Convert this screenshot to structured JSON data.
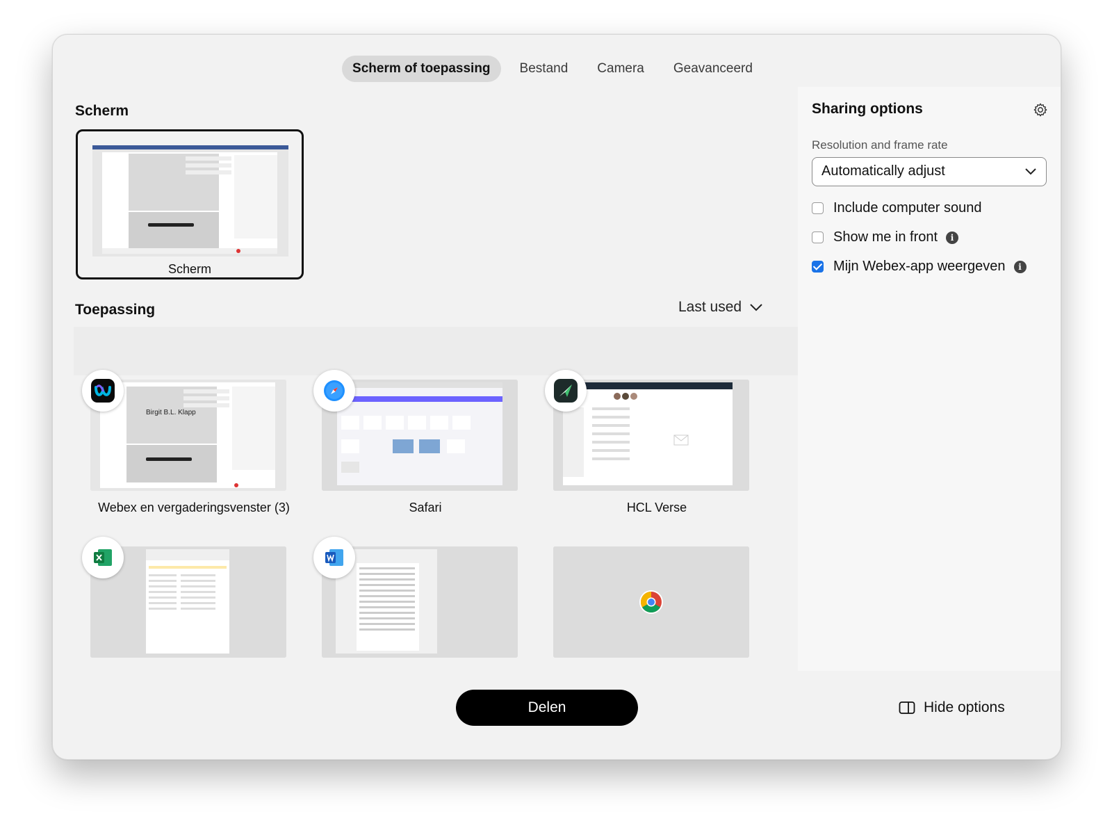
{
  "tabs": [
    {
      "label": "Scherm of toepassing",
      "active": true
    },
    {
      "label": "Bestand",
      "active": false
    },
    {
      "label": "Camera",
      "active": false
    },
    {
      "label": "Geavanceerd",
      "active": false
    }
  ],
  "screen_section": {
    "title": "Scherm",
    "card_label": "Scherm"
  },
  "app_section": {
    "title": "Toepassing",
    "sort_label": "Last used",
    "apps": [
      {
        "label": "Webex en vergaderingsvenster (3)",
        "icon": "webex-icon",
        "thumb_text": "Birgit B.L. Klapp"
      },
      {
        "label": "Safari",
        "icon": "safari-icon"
      },
      {
        "label": "HCL Verse",
        "icon": "hcl-verse-icon"
      },
      {
        "label": "",
        "icon": "excel-icon"
      },
      {
        "label": "",
        "icon": "word-icon"
      },
      {
        "label": "",
        "icon": "chrome-icon"
      }
    ]
  },
  "sharing_options": {
    "title": "Sharing options",
    "resolution_label": "Resolution and frame rate",
    "resolution_value": "Automatically adjust",
    "options": [
      {
        "label": "Include computer sound",
        "checked": false,
        "info": false
      },
      {
        "label": "Show me in front",
        "checked": false,
        "info": true
      },
      {
        "label": "Mijn Webex-app weergeven",
        "checked": true,
        "info": true
      }
    ]
  },
  "footer": {
    "share_label": "Delen",
    "hide_options_label": "Hide options"
  },
  "colors": {
    "accent": "#1a73e8",
    "primary_button": "#000000"
  }
}
